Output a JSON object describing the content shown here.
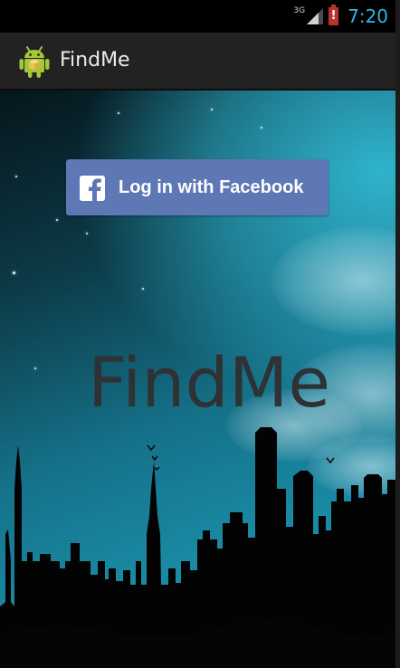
{
  "status_bar": {
    "network_label": "3G",
    "signal_icon": "signal-strength-icon",
    "battery_icon": "battery-alert-icon",
    "battery_mark": "!",
    "time": "7:20",
    "accent_color": "#33b5e5"
  },
  "action_bar": {
    "app_icon": "android-robot-icon",
    "title": "FindMe"
  },
  "main": {
    "login_button": {
      "icon": "facebook-f-icon",
      "label": "Log in with Facebook",
      "color": "#5e77b5"
    },
    "hero_title": "FindMe",
    "background": "night-city-skyline"
  }
}
